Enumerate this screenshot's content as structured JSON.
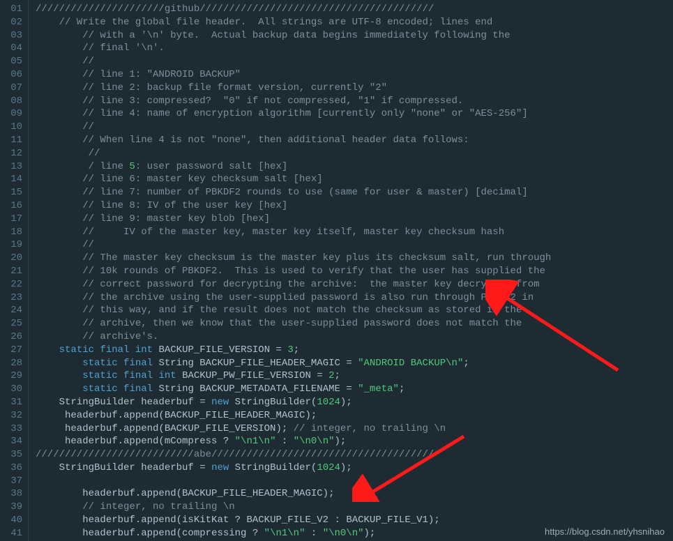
{
  "watermark": "https://blog.csdn.net/yhsnihao",
  "lines": [
    {
      "n": "01",
      "tokens": [
        {
          "cls": "c-comment",
          "t": "//////////////////////github////////////////////////////////////////"
        }
      ]
    },
    {
      "n": "02",
      "tokens": [
        {
          "cls": "c-comment",
          "t": "    // Write the global file header.  All strings are UTF-8 encoded; lines end"
        }
      ]
    },
    {
      "n": "03",
      "tokens": [
        {
          "cls": "c-comment",
          "t": "        // with a '\\n' byte.  Actual backup data begins immediately following the"
        }
      ]
    },
    {
      "n": "04",
      "tokens": [
        {
          "cls": "c-comment",
          "t": "        // final '\\n'."
        }
      ]
    },
    {
      "n": "05",
      "tokens": [
        {
          "cls": "c-comment",
          "t": "        //"
        }
      ]
    },
    {
      "n": "06",
      "tokens": [
        {
          "cls": "c-comment",
          "t": "        // line 1: \"ANDROID BACKUP\""
        }
      ]
    },
    {
      "n": "07",
      "tokens": [
        {
          "cls": "c-comment",
          "t": "        // line 2: backup file format version, currently \"2\""
        }
      ]
    },
    {
      "n": "08",
      "tokens": [
        {
          "cls": "c-comment",
          "t": "        // line 3: compressed?  \"0\" if not compressed, \"1\" if compressed."
        }
      ]
    },
    {
      "n": "09",
      "tokens": [
        {
          "cls": "c-comment",
          "t": "        // line 4: name of encryption algorithm [currently only \"none\" or \"AES-256\"]"
        }
      ]
    },
    {
      "n": "10",
      "tokens": [
        {
          "cls": "c-comment",
          "t": "        //"
        }
      ]
    },
    {
      "n": "11",
      "tokens": [
        {
          "cls": "c-comment",
          "t": "        // When line 4 is not \"none\", then additional header data follows:"
        }
      ]
    },
    {
      "n": "12",
      "tokens": [
        {
          "cls": "c-comment",
          "t": "         //"
        }
      ]
    },
    {
      "n": "13",
      "tokens": [
        {
          "cls": "c-comment",
          "t": "         / line "
        },
        {
          "cls": "c-num",
          "t": "5"
        },
        {
          "cls": "c-comment",
          "t": ": user password salt [hex]"
        }
      ]
    },
    {
      "n": "14",
      "tokens": [
        {
          "cls": "c-comment",
          "t": "        // line 6: master key checksum salt [hex]"
        }
      ]
    },
    {
      "n": "15",
      "tokens": [
        {
          "cls": "c-comment",
          "t": "        // line 7: number of PBKDF2 rounds to use (same for user & master) [decimal]"
        }
      ]
    },
    {
      "n": "16",
      "tokens": [
        {
          "cls": "c-comment",
          "t": "        // line 8: IV of the user key [hex]"
        }
      ]
    },
    {
      "n": "17",
      "tokens": [
        {
          "cls": "c-comment",
          "t": "        // line 9: master key blob [hex]"
        }
      ]
    },
    {
      "n": "18",
      "tokens": [
        {
          "cls": "c-comment",
          "t": "        //     IV of the master key, master key itself, master key checksum hash"
        }
      ]
    },
    {
      "n": "19",
      "tokens": [
        {
          "cls": "c-comment",
          "t": "        //"
        }
      ]
    },
    {
      "n": "20",
      "tokens": [
        {
          "cls": "c-comment",
          "t": "        // The master key checksum is the master key plus its checksum salt, run through"
        }
      ]
    },
    {
      "n": "21",
      "tokens": [
        {
          "cls": "c-comment",
          "t": "        // 10k rounds of PBKDF2.  This is used to verify that the user has supplied the"
        }
      ]
    },
    {
      "n": "22",
      "tokens": [
        {
          "cls": "c-comment",
          "t": "        // correct password for decrypting the archive:  the master key decrypted from"
        }
      ]
    },
    {
      "n": "23",
      "tokens": [
        {
          "cls": "c-comment",
          "t": "        // the archive using the user-supplied password is also run through PBKDF2 in"
        }
      ]
    },
    {
      "n": "24",
      "tokens": [
        {
          "cls": "c-comment",
          "t": "        // this way, and if the result does not match the checksum as stored in the"
        }
      ]
    },
    {
      "n": "25",
      "tokens": [
        {
          "cls": "c-comment",
          "t": "        // archive, then we know that the user-supplied password does not match the"
        }
      ]
    },
    {
      "n": "26",
      "tokens": [
        {
          "cls": "c-comment",
          "t": "        // archive's."
        }
      ]
    },
    {
      "n": "27",
      "tokens": [
        {
          "cls": "c-ident",
          "t": "    "
        },
        {
          "cls": "c-kw",
          "t": "static"
        },
        {
          "cls": "c-ident",
          "t": " "
        },
        {
          "cls": "c-kw",
          "t": "final"
        },
        {
          "cls": "c-ident",
          "t": " "
        },
        {
          "cls": "c-kw",
          "t": "int"
        },
        {
          "cls": "c-ident",
          "t": " BACKUP_FILE_VERSION "
        },
        {
          "cls": "c-op",
          "t": "= "
        },
        {
          "cls": "c-num",
          "t": "3"
        },
        {
          "cls": "c-op",
          "t": ";"
        }
      ]
    },
    {
      "n": "28",
      "tokens": [
        {
          "cls": "c-ident",
          "t": "        "
        },
        {
          "cls": "c-kw",
          "t": "static"
        },
        {
          "cls": "c-ident",
          "t": " "
        },
        {
          "cls": "c-kw",
          "t": "final"
        },
        {
          "cls": "c-ident",
          "t": " String BACKUP_FILE_HEADER_MAGIC "
        },
        {
          "cls": "c-op",
          "t": "= "
        },
        {
          "cls": "c-str",
          "t": "\"ANDROID BACKUP\\n\""
        },
        {
          "cls": "c-op",
          "t": ";"
        }
      ]
    },
    {
      "n": "29",
      "tokens": [
        {
          "cls": "c-ident",
          "t": "        "
        },
        {
          "cls": "c-kw",
          "t": "static"
        },
        {
          "cls": "c-ident",
          "t": " "
        },
        {
          "cls": "c-kw",
          "t": "final"
        },
        {
          "cls": "c-ident",
          "t": " "
        },
        {
          "cls": "c-kw",
          "t": "int"
        },
        {
          "cls": "c-ident",
          "t": " BACKUP_PW_FILE_VERSION "
        },
        {
          "cls": "c-op",
          "t": "= "
        },
        {
          "cls": "c-num",
          "t": "2"
        },
        {
          "cls": "c-op",
          "t": ";"
        }
      ]
    },
    {
      "n": "30",
      "tokens": [
        {
          "cls": "c-ident",
          "t": "        "
        },
        {
          "cls": "c-kw",
          "t": "static"
        },
        {
          "cls": "c-ident",
          "t": " "
        },
        {
          "cls": "c-kw",
          "t": "final"
        },
        {
          "cls": "c-ident",
          "t": " String BACKUP_METADATA_FILENAME "
        },
        {
          "cls": "c-op",
          "t": "= "
        },
        {
          "cls": "c-str",
          "t": "\"_meta\""
        },
        {
          "cls": "c-op",
          "t": ";"
        }
      ]
    },
    {
      "n": "31",
      "tokens": [
        {
          "cls": "c-ident",
          "t": "    StringBuilder headerbuf "
        },
        {
          "cls": "c-op",
          "t": "= "
        },
        {
          "cls": "c-kw",
          "t": "new"
        },
        {
          "cls": "c-ident",
          "t": " StringBuilder("
        },
        {
          "cls": "c-num",
          "t": "1024"
        },
        {
          "cls": "c-ident",
          "t": ");"
        }
      ]
    },
    {
      "n": "32",
      "tokens": [
        {
          "cls": "c-ident",
          "t": "     headerbuf.append(BACKUP_FILE_HEADER_MAGIC);"
        }
      ]
    },
    {
      "n": "33",
      "tokens": [
        {
          "cls": "c-ident",
          "t": "     headerbuf.append(BACKUP_FILE_VERSION); "
        },
        {
          "cls": "c-comment",
          "t": "// integer, no trailing \\n"
        }
      ]
    },
    {
      "n": "34",
      "tokens": [
        {
          "cls": "c-ident",
          "t": "     headerbuf.append(mCompress "
        },
        {
          "cls": "c-op",
          "t": "? "
        },
        {
          "cls": "c-str",
          "t": "\"\\n1\\n\""
        },
        {
          "cls": "c-op",
          "t": " : "
        },
        {
          "cls": "c-str",
          "t": "\"\\n0\\n\""
        },
        {
          "cls": "c-ident",
          "t": ");"
        }
      ]
    },
    {
      "n": "35",
      "tokens": [
        {
          "cls": "c-comment",
          "t": "///////////////////////////abe//////////////////////////////////////"
        }
      ]
    },
    {
      "n": "36",
      "tokens": [
        {
          "cls": "c-ident",
          "t": "    StringBuilder headerbuf "
        },
        {
          "cls": "c-op",
          "t": "= "
        },
        {
          "cls": "c-kw",
          "t": "new"
        },
        {
          "cls": "c-ident",
          "t": " StringBuilder("
        },
        {
          "cls": "c-num",
          "t": "1024"
        },
        {
          "cls": "c-ident",
          "t": ");"
        }
      ]
    },
    {
      "n": "37",
      "tokens": [
        {
          "cls": "c-ident",
          "t": ""
        }
      ]
    },
    {
      "n": "38",
      "tokens": [
        {
          "cls": "c-ident",
          "t": "        headerbuf.append(BACKUP_FILE_HEADER_MAGIC);"
        }
      ]
    },
    {
      "n": "39",
      "tokens": [
        {
          "cls": "c-ident",
          "t": "        "
        },
        {
          "cls": "c-comment",
          "t": "// integer, no trailing \\n"
        }
      ]
    },
    {
      "n": "40",
      "tokens": [
        {
          "cls": "c-ident",
          "t": "        headerbuf.append(isKitKat "
        },
        {
          "cls": "c-op",
          "t": "? "
        },
        {
          "cls": "c-ident",
          "t": "BACKUP_FILE_V2 "
        },
        {
          "cls": "c-op",
          "t": ": "
        },
        {
          "cls": "c-ident",
          "t": "BACKUP_FILE_V1);"
        }
      ]
    },
    {
      "n": "41",
      "tokens": [
        {
          "cls": "c-ident",
          "t": "        headerbuf.append(compressing "
        },
        {
          "cls": "c-op",
          "t": "? "
        },
        {
          "cls": "c-str",
          "t": "\"\\n1\\n\""
        },
        {
          "cls": "c-op",
          "t": " : "
        },
        {
          "cls": "c-str",
          "t": "\"\\n0\\n\""
        },
        {
          "cls": "c-ident",
          "t": ");"
        }
      ]
    }
  ]
}
